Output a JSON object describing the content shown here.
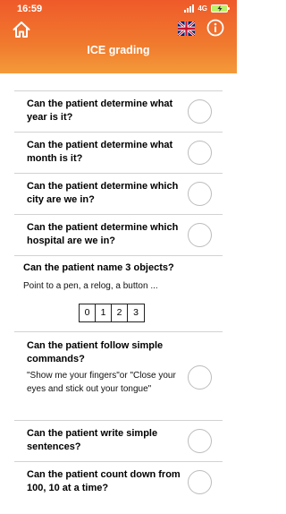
{
  "status": {
    "time": "16:59",
    "network": "4G"
  },
  "header": {
    "title": "ICE grading"
  },
  "questions": [
    {
      "text": "Can the patient determine what year is it?"
    },
    {
      "text": "Can the patient determine what month is it?"
    },
    {
      "text": "Can the patient determine which city are we in?"
    },
    {
      "text": "Can the patient determine which hospital are we in?"
    },
    {
      "text": "Can the patient name 3 objects?",
      "hint": "Point to a pen, a relog, a button ...",
      "scores": [
        "0",
        "1",
        "2",
        "3"
      ]
    },
    {
      "text": "Can the patient follow simple commands?",
      "hint": "\"Show me your fingers\"or \"Close your eyes and stick out your tongue\""
    },
    {
      "text": "Can the patient write simple sentences?"
    },
    {
      "text": "Can the patient count down from 100, 10 at a time?"
    }
  ],
  "colors": {
    "header_top": "#ef5a2a",
    "header_bottom": "#f49a3a",
    "divider": "#d2d2d2"
  },
  "icons": {
    "home": "home-icon",
    "language": "uk-flag-icon",
    "info": "info-icon"
  }
}
